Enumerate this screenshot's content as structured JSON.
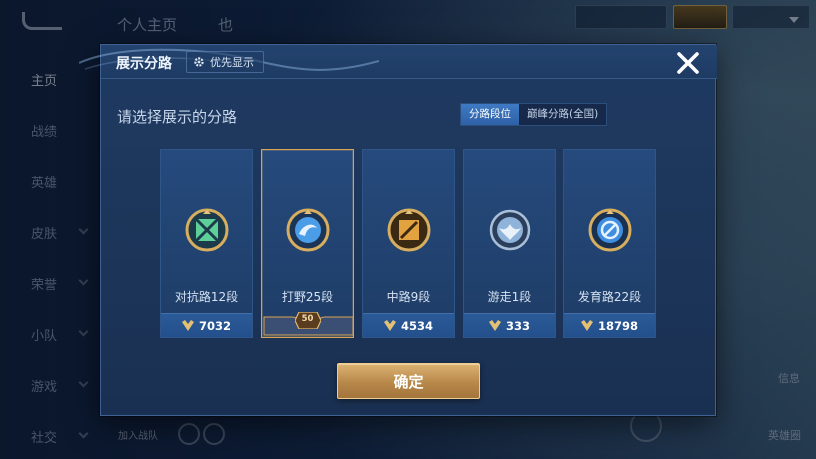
{
  "background": {
    "top_tabs": [
      "个人主页",
      "也"
    ],
    "sidebar": [
      "主页",
      "战绩",
      "英雄",
      "皮肤",
      "荣誉",
      "小队",
      "游戏",
      "社交"
    ],
    "right_labels": [
      "信息",
      "英雄圈"
    ],
    "bottom_left_text": "加入战队"
  },
  "dialog": {
    "title": "展示分路",
    "priority_button": "优先显示",
    "subtitle": "请选择展示的分路",
    "segment": {
      "options": [
        "分路段位",
        "巅峰分路(全国)"
      ],
      "selected_index": 0
    },
    "lanes": [
      {
        "name": "对抗路12段",
        "points": "7032",
        "emblem": "clash-lane-emblem-icon",
        "color": "#5fcf9a",
        "selected": false
      },
      {
        "name": "打野25段",
        "points": "",
        "emblem": "jungle-emblem-icon",
        "color": "#4a9de6",
        "selected": true,
        "badge": "50"
      },
      {
        "name": "中路9段",
        "points": "4534",
        "emblem": "mid-lane-emblem-icon",
        "color": "#e2a240",
        "selected": false
      },
      {
        "name": "游走1段",
        "points": "333",
        "emblem": "roam-emblem-icon",
        "color": "#8fb3d9",
        "selected": false
      },
      {
        "name": "发育路22段",
        "points": "18798",
        "emblem": "farm-lane-emblem-icon",
        "color": "#3f8fe0",
        "selected": false
      }
    ],
    "confirm_label": "确定",
    "colors": {
      "accent_gold": "#d9a356",
      "panel_bg": "#1f3a62",
      "active_tab": "#3f7ac4"
    }
  }
}
